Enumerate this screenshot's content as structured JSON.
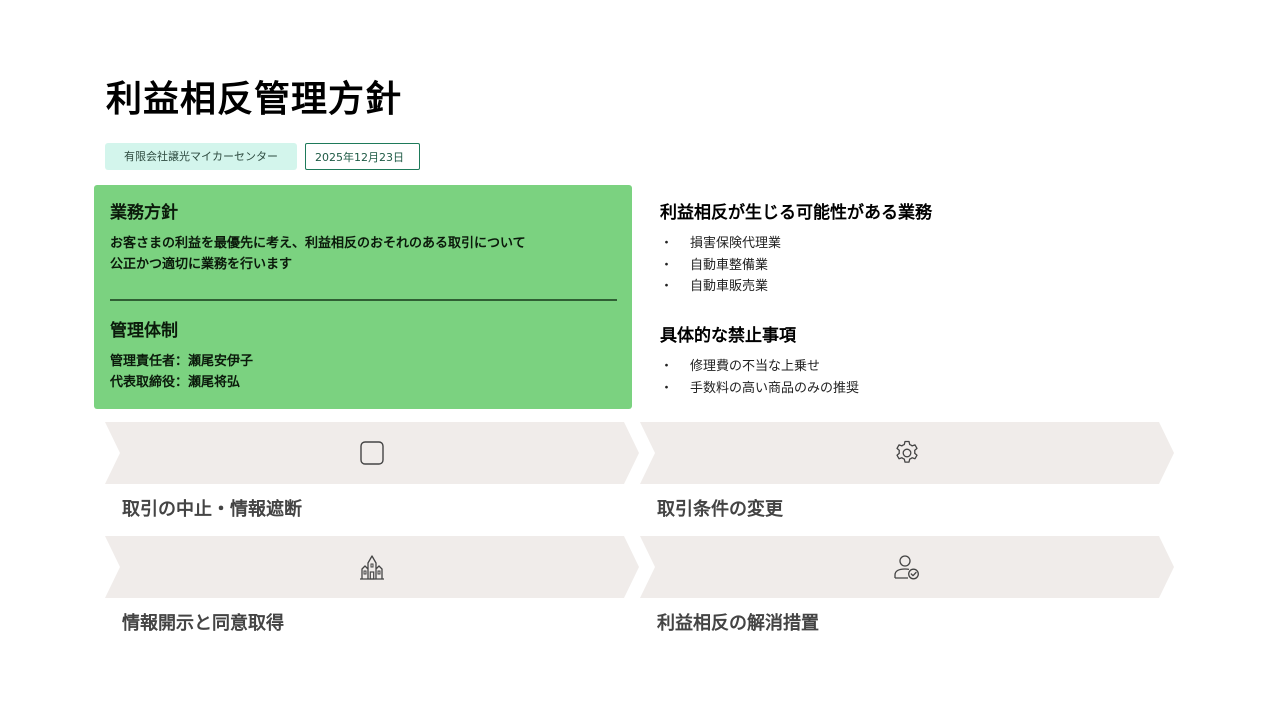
{
  "title": "利益相反管理方針",
  "company_name": "有限会社譲光マイカーセンター",
  "date": "2025年12月23日",
  "policy": {
    "heading": "業務方針",
    "lines": [
      "お客さまの利益を最優先に考え、利益相反のおそれのある取引について",
      "公正かつ適切に業務を行います"
    ]
  },
  "management": {
    "heading": "管理体制",
    "lines": [
      "管理責任者：瀬尾安伊子",
      "代表取締役：瀬尾将弘"
    ]
  },
  "conflict_business": {
    "heading": "利益相反が生じる可能性がある業務",
    "items": [
      "損害保険代理業",
      "自動車整備業",
      "自動車販売業"
    ]
  },
  "prohibited": {
    "heading": "具体的な禁止事項",
    "items": [
      "修理費の不当な上乗せ",
      "手数料の高い商品のみの推奨"
    ]
  },
  "bullet_char": "・",
  "measures": [
    {
      "label": "取引の中止・情報遮断",
      "icon": "square-icon"
    },
    {
      "label": "取引条件の変更",
      "icon": "gear-icon"
    },
    {
      "label": "情報開示と同意取得",
      "icon": "building-icon"
    },
    {
      "label": "利益相反の解消措置",
      "icon": "user-check-icon"
    }
  ]
}
